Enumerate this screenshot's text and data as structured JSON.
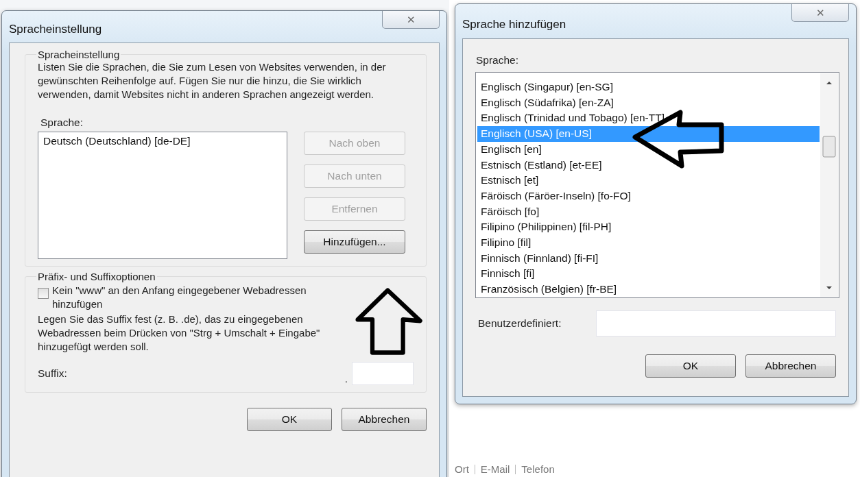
{
  "language_settings_dialog": {
    "title": "Spracheinstellung",
    "close": "✕",
    "language_group": {
      "title": "Spracheinstellung",
      "description": "Listen Sie die Sprachen, die Sie zum Lesen von Websites verwenden, in der gewünschten Reihenfolge auf. Fügen Sie nur die hinzu, die Sie wirklich verwenden, damit Websites nicht in anderen Sprachen angezeigt werden.",
      "list_label": "Sprache:",
      "languages": [
        {
          "label": "Deutsch (Deutschland) [de-DE]",
          "selected": false
        }
      ],
      "buttons": [
        {
          "label": "Nach oben",
          "disabled": true
        },
        {
          "label": "Nach unten",
          "disabled": true
        },
        {
          "label": "Entfernen",
          "disabled": true
        },
        {
          "label": "Hinzufügen...",
          "disabled": false
        }
      ]
    },
    "prefix_group": {
      "title": "Präfix- und Suffixoptionen",
      "checkbox": {
        "label": "Kein \"www\" an den Anfang eingegebener Webadressen hinzufügen",
        "checked": false
      },
      "description": "Legen Sie das Suffix fest (z. B. .de), das zu eingegebenen Webadressen beim Drücken von \"Strg + Umschalt + Eingabe\" hinzugefügt werden soll.",
      "suffix_label": "Suffix:",
      "suffix_dot": "."
    },
    "buttons": [
      "OK",
      "Abbrechen"
    ]
  },
  "add_language_dialog": {
    "title": "Sprache hinzufügen",
    "close": "✕",
    "list_label": "Sprache:",
    "languages": [
      {
        "label": "Englisch (Singapur) [en-SG]",
        "selected": false
      },
      {
        "label": "Englisch (Südafrika) [en-ZA]",
        "selected": false
      },
      {
        "label": "Englisch (Trinidad und Tobago) [en-TT]",
        "selected": false
      },
      {
        "label": "Englisch (USA) [en-US]",
        "selected": true
      },
      {
        "label": "Englisch [en]",
        "selected": false
      },
      {
        "label": "Estnisch (Estland) [et-EE]",
        "selected": false
      },
      {
        "label": "Estnisch [et]",
        "selected": false
      },
      {
        "label": "Färöisch (Färöer-Inseln) [fo-FO]",
        "selected": false
      },
      {
        "label": "Färöisch [fo]",
        "selected": false
      },
      {
        "label": "Filipino (Philippinen) [fil-PH]",
        "selected": false
      },
      {
        "label": "Filipino [fil]",
        "selected": false
      },
      {
        "label": "Finnisch (Finnland) [fi-FI]",
        "selected": false
      },
      {
        "label": "Finnisch [fi]",
        "selected": false
      },
      {
        "label": "Französisch (Belgien) [fr-BE]",
        "selected": false
      }
    ],
    "custom_label": "Benutzerdefiniert:",
    "buttons": [
      "OK",
      "Abbrechen"
    ]
  },
  "footer_links": [
    "Ort",
    "E-Mail",
    "Telefon"
  ]
}
